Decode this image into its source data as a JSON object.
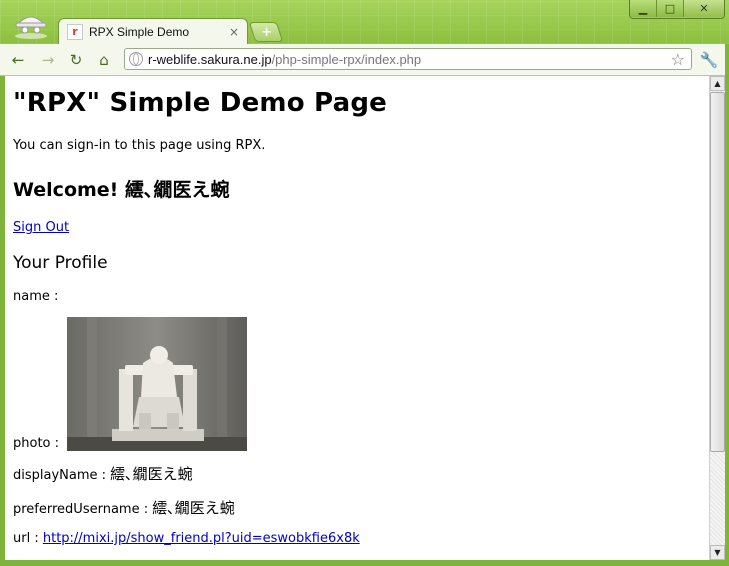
{
  "window": {
    "controls": {
      "minimize_icon": "minimize-icon",
      "maximize_icon": "maximize-icon",
      "close_icon": "close-icon"
    }
  },
  "tab": {
    "title": "RPX Simple Demo",
    "favicon_letter": "r",
    "close_glyph": "×",
    "new_tab_glyph": "+"
  },
  "toolbar": {
    "back_icon": "back-arrow-icon",
    "forward_icon": "forward-arrow-icon",
    "reload_icon": "reload-icon",
    "home_icon": "home-icon",
    "url_host": "r-weblife.sakura.ne.jp",
    "url_path": "/php-simple-rpx/index.php",
    "bookmark_icon": "star-icon",
    "menu_icon": "wrench-icon"
  },
  "page": {
    "title": "\"RPX\" Simple Demo Page",
    "intro": "You can sign-in to this page using RPX.",
    "welcome": "Welcome! 繧､繝医え蜿",
    "sign_out": "Sign Out",
    "profile_heading": "Your Profile",
    "name_label": "name :",
    "name_value": "",
    "photo_label": "photo :",
    "display_name_label": "displayName :",
    "display_name_value": "繧､繝医え蜿",
    "preferred_username_label": "preferredUsername :",
    "preferred_username_value": "繧､繝医え蜿",
    "url_label": "url :",
    "url_value": "http://mixi.jp/show_friend.pl?uid=eswobkfie6x8k"
  }
}
